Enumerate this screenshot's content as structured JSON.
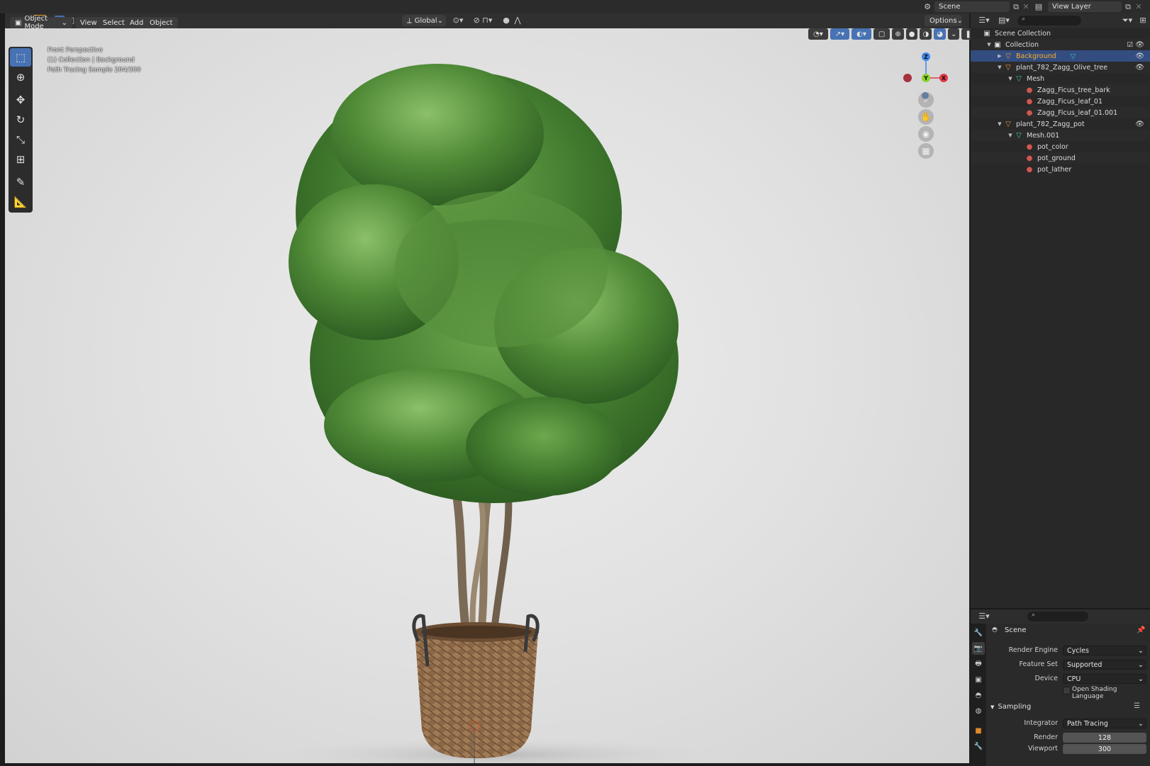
{
  "topbar": {
    "scene_label": "Scene",
    "view_layer_label": "View Layer"
  },
  "viewport_header": {
    "transform_orientation": "Global",
    "options_label": "Options",
    "mode_label": "Object Mode",
    "menus": [
      "View",
      "Select",
      "Add",
      "Object"
    ]
  },
  "viewport": {
    "overlay_lines": [
      "Front Perspective",
      "(1) Collection | Background",
      "Path Tracing Sample 204/300"
    ],
    "gizmo": {
      "z": "Z",
      "y": "Y",
      "x": "X"
    }
  },
  "tools": [
    "select-box",
    "cursor",
    "move",
    "rotate",
    "scale",
    "transform",
    "annotate",
    "measure"
  ],
  "outliner": {
    "items": [
      {
        "label": "Scene Collection",
        "indent": 0,
        "icon": "scene-collection-icon",
        "arrow": ""
      },
      {
        "label": "Collection",
        "indent": 1,
        "icon": "collection-icon",
        "arrow": "▼",
        "checkbox": true,
        "eye": true
      },
      {
        "label": "Background",
        "indent": 2,
        "icon": "object-icon",
        "arrow": "▶",
        "selected": true,
        "eye": true
      },
      {
        "label": "plant_782_Zagg_Olive_tree",
        "indent": 2,
        "icon": "object-icon",
        "arrow": "▼",
        "eye": true
      },
      {
        "label": "Mesh",
        "indent": 3,
        "icon": "mesh-icon",
        "arrow": "▼"
      },
      {
        "label": "Zagg_Ficus_tree_bark",
        "indent": 4,
        "icon": "material-icon",
        "arrow": ""
      },
      {
        "label": "Zagg_Ficus_leaf_01",
        "indent": 4,
        "icon": "material-icon",
        "arrow": ""
      },
      {
        "label": "Zagg_Ficus_leaf_01.001",
        "indent": 4,
        "icon": "material-icon",
        "arrow": ""
      },
      {
        "label": "plant_782_Zagg_pot",
        "indent": 2,
        "icon": "object-icon",
        "arrow": "▼",
        "eye": true
      },
      {
        "label": "Mesh.001",
        "indent": 3,
        "icon": "mesh-icon",
        "arrow": "▼"
      },
      {
        "label": "pot_color",
        "indent": 4,
        "icon": "material-icon",
        "arrow": ""
      },
      {
        "label": "pot_ground",
        "indent": 4,
        "icon": "material-icon",
        "arrow": ""
      },
      {
        "label": "pot_lather",
        "indent": 4,
        "icon": "material-icon",
        "arrow": ""
      }
    ]
  },
  "properties": {
    "context_label": "Scene",
    "render_engine_label": "Render Engine",
    "render_engine_value": "Cycles",
    "feature_set_label": "Feature Set",
    "feature_set_value": "Supported",
    "device_label": "Device",
    "device_value": "CPU",
    "osl_label": "Open Shading Language",
    "sampling_label": "Sampling",
    "integrator_label": "Integrator",
    "integrator_value": "Path Tracing",
    "render_label": "Render",
    "render_value": "128",
    "viewport_label": "Viewport",
    "viewport_value": "300"
  },
  "colors": {
    "accent": "#4772b3",
    "selected_text": "#ffaf29",
    "axis_x": "#e3394b",
    "axis_y": "#8bd32a",
    "axis_z": "#3f86e8"
  }
}
